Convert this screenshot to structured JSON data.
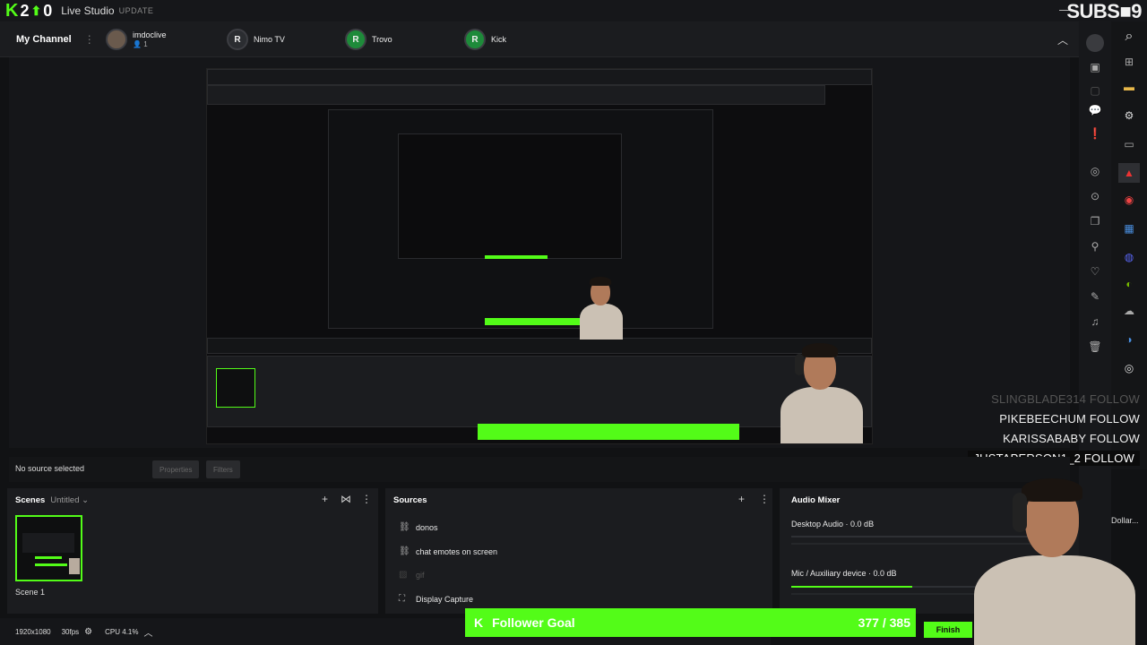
{
  "app": {
    "title": "Live Studio",
    "update_label": "UPDATE",
    "subs_counter": "SUBS■9",
    "minimize": "—"
  },
  "channel_bar": {
    "my_channel": "My Channel",
    "platforms": [
      {
        "name": "imdoclive",
        "viewers": "1",
        "avatar_letter": ""
      },
      {
        "name": "Nimo TV",
        "avatar_letter": "R"
      },
      {
        "name": "Trovo",
        "avatar_letter": "R"
      },
      {
        "name": "Kick",
        "avatar_letter": "R"
      }
    ]
  },
  "follow_events": [
    {
      "user": "SLINGBLADE314",
      "action": "FOLLOW"
    },
    {
      "user": "PIKEBEECHUM",
      "action": "FOLLOW"
    },
    {
      "user": "KARISSABABY",
      "action": "FOLLOW"
    },
    {
      "user": "JUSTAPERSON1_2",
      "action": "FOLLOW"
    }
  ],
  "source_bar": {
    "no_source": "No source selected",
    "properties": "Properties",
    "filters": "Filters"
  },
  "scenes": {
    "title": "Scenes",
    "collection": "Untitled",
    "items": [
      {
        "label": "Scene 1"
      }
    ]
  },
  "sources": {
    "title": "Sources",
    "items": [
      {
        "label": "donos",
        "icon": "link-icon"
      },
      {
        "label": "chat emotes on screen",
        "icon": "link-icon"
      },
      {
        "label": "gif",
        "icon": "image-icon"
      },
      {
        "label": "Display Capture",
        "icon": "display-icon"
      }
    ]
  },
  "audio_mixer": {
    "title": "Audio Mixer",
    "channels": [
      {
        "label": "Desktop Audio",
        "db": "0.0 dB",
        "level": 0.0
      },
      {
        "label": "Mic / Auxiliary device",
        "db": "0.0 dB",
        "level": 0.5
      }
    ]
  },
  "status": {
    "resolution": "1920x1080",
    "fps": "30fps",
    "cpu": "CPU 4.1%"
  },
  "follower_goal": {
    "label": "Follower Goal",
    "count": "377 / 385",
    "progress": 0.979,
    "finish": "Finish"
  },
  "side_widget": {
    "label": "Dollar..."
  },
  "colors": {
    "accent": "#53fc18",
    "background": "#111214",
    "panel": "#1b1c1f"
  }
}
